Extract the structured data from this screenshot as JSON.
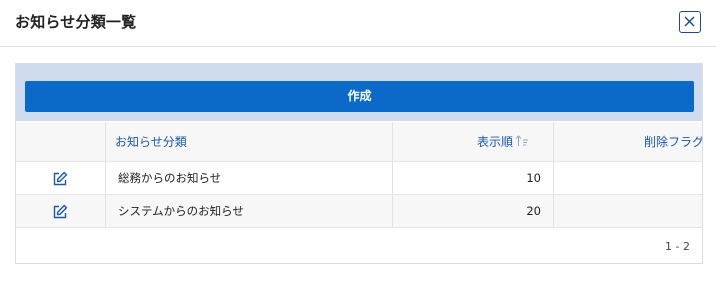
{
  "dialog": {
    "title": "お知らせ分類一覧",
    "close_icon": "close-icon"
  },
  "actions": {
    "create_label": "作成"
  },
  "table": {
    "columns": [
      {
        "label": "お知らせ分類"
      },
      {
        "label": "表示順",
        "sort_icon": "sort-ascending-icon"
      },
      {
        "label": "削除フラグ"
      }
    ],
    "rows": [
      {
        "category": "総務からのお知らせ",
        "order": "10",
        "delete_flag": "",
        "edit_icon": "edit-icon"
      },
      {
        "category": "システムからのお知らせ",
        "order": "20",
        "delete_flag": "",
        "edit_icon": "edit-icon"
      }
    ]
  },
  "pagination": {
    "range": "1 - 2"
  },
  "colors": {
    "primary": "#0b6ac8",
    "action_bar_bg": "#cfdcef",
    "header_link": "#1a5aa6",
    "close_border": "#1b4e86"
  }
}
